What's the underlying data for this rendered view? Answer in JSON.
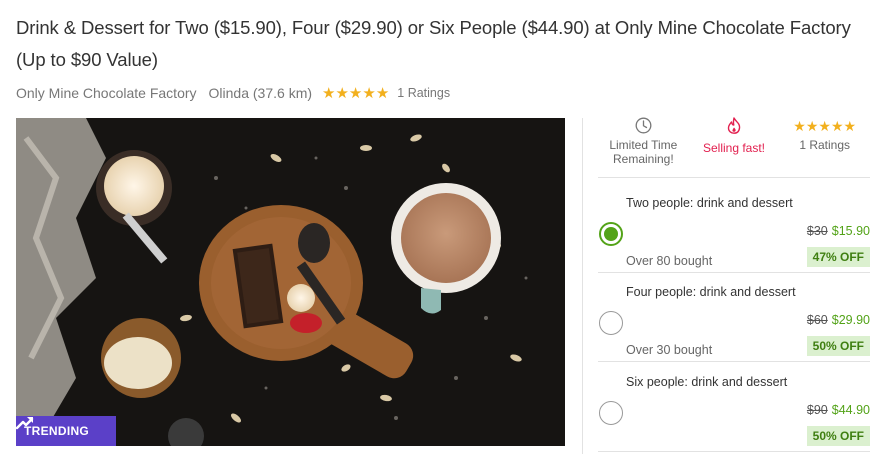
{
  "deal": {
    "title": "Drink & Dessert for Two ($15.90), Four ($29.90) or Six People ($44.90) at Only Mine Chocolate Factory (Up to $90 Value)",
    "merchant": "Only Mine Chocolate Factory",
    "location": "Olinda (37.6 km)",
    "rating_stars": 5,
    "ratings_text": "1 Ratings"
  },
  "photo": {
    "badge_label": "TRENDING",
    "badge_color": "#5b40c8"
  },
  "info": {
    "limited_time": "Limited Time Remaining!",
    "selling_fast": "Selling fast!",
    "ratings": "1 Ratings",
    "selling_fast_color": "#e2204f"
  },
  "options": [
    {
      "title": "Two people: drink and dessert",
      "old_price": "$30",
      "new_price": "$15.90",
      "bought": "Over 80 bought",
      "discount": "47% OFF",
      "selected": true
    },
    {
      "title": "Four people: drink and dessert",
      "old_price": "$60",
      "new_price": "$29.90",
      "bought": "Over 30 bought",
      "discount": "50% OFF",
      "selected": false
    },
    {
      "title": "Six people: drink and dessert",
      "old_price": "$90",
      "new_price": "$44.90",
      "bought": "",
      "discount": "50% OFF",
      "selected": false
    }
  ],
  "colors": {
    "accent_green": "#53a318",
    "star": "#f2b01e"
  }
}
